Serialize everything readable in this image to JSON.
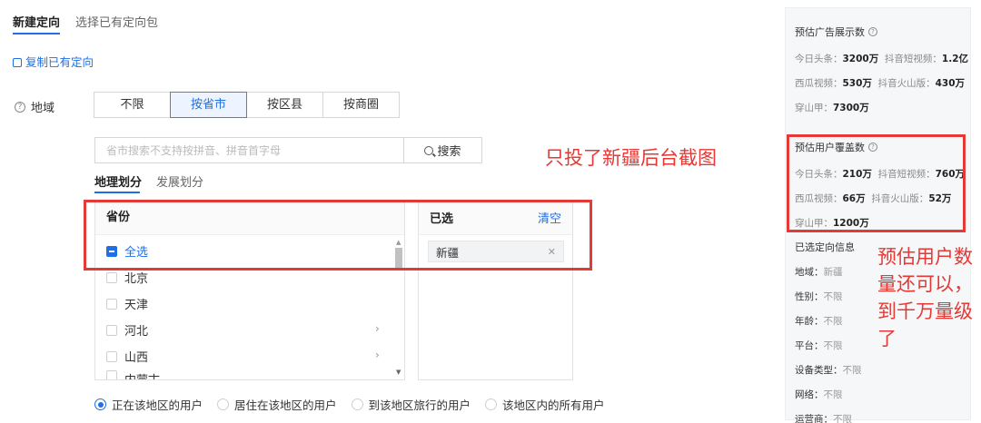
{
  "tabs": {
    "active": "新建定向",
    "inactive": "选择已有定向包"
  },
  "copy_link": "复制已有定向",
  "region": {
    "label": "地域",
    "segments": [
      "不限",
      "按省市",
      "按区县",
      "按商圈"
    ],
    "active_segment": "按省市"
  },
  "search": {
    "placeholder": "省市搜索不支持按拼音、拼音首字母",
    "button": "搜索"
  },
  "subtabs": {
    "active": "地理划分",
    "inactive": "发展划分"
  },
  "province_panel": {
    "header": "省份",
    "select_all": "全选",
    "items": [
      {
        "label": "北京",
        "has_children": false
      },
      {
        "label": "天津",
        "has_children": false
      },
      {
        "label": "河北",
        "has_children": true
      },
      {
        "label": "山西",
        "has_children": true
      },
      {
        "label": "内蒙古",
        "has_children": true
      }
    ]
  },
  "selected_panel": {
    "header": "已选",
    "clear": "清空",
    "tags": [
      "新疆"
    ]
  },
  "radios": [
    {
      "label": "正在该地区的用户",
      "checked": true
    },
    {
      "label": "居住在该地区的用户",
      "checked": false
    },
    {
      "label": "到该地区旅行的用户",
      "checked": false
    },
    {
      "label": "该地区内的所有用户",
      "checked": false
    }
  ],
  "annotations": {
    "note1": "只投了新疆后台截图",
    "note2": "预估用户数量还可以，到千万量级了"
  },
  "sidebar": {
    "impressions": {
      "title": "预估广告展示数",
      "rows": [
        [
          {
            "k": "今日头条：",
            "v": "3200万"
          },
          {
            "k": "抖音短视频：",
            "v": "1.2亿"
          }
        ],
        [
          {
            "k": "西瓜视频：",
            "v": "530万"
          },
          {
            "k": "抖音火山版：",
            "v": "430万"
          }
        ],
        [
          {
            "k": "穿山甲：",
            "v": "7300万"
          }
        ]
      ]
    },
    "coverage": {
      "title": "预估用户覆盖数",
      "rows": [
        [
          {
            "k": "今日头条：",
            "v": "210万"
          },
          {
            "k": "抖音短视频：",
            "v": "760万"
          }
        ],
        [
          {
            "k": "西瓜视频：",
            "v": "66万"
          },
          {
            "k": "抖音火山版：",
            "v": "52万"
          }
        ],
        [
          {
            "k": "穿山甲：",
            "v": "1200万"
          }
        ]
      ]
    },
    "info": {
      "title": "已选定向信息",
      "items": [
        {
          "k": "地域：",
          "v": "新疆"
        },
        {
          "k": "性别：",
          "v": "不限"
        },
        {
          "k": "年龄：",
          "v": "不限"
        },
        {
          "k": "平台：",
          "v": "不限"
        },
        {
          "k": "设备类型：",
          "v": "不限"
        },
        {
          "k": "网络：",
          "v": "不限"
        },
        {
          "k": "运营商：",
          "v": "不限"
        }
      ]
    }
  },
  "colors": {
    "accent": "#1f6fe5",
    "annotation_red": "#e53935"
  }
}
